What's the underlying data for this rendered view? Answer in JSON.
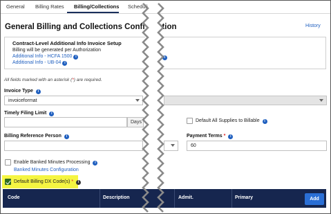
{
  "tabs": [
    {
      "label": "General"
    },
    {
      "label": "Billing Rates"
    },
    {
      "label": "Billing/Collections"
    },
    {
      "label": "Scheduli"
    }
  ],
  "page_title": "General Billing and Collections Configuration",
  "history_link": "History",
  "setup": {
    "title": "Contract-Level Additional Info Invoice Setup",
    "subtitle": "Billing will be generated per Authorization",
    "links": [
      "Additional Info - HCFA 1500",
      "Additional Info - UB-04"
    ]
  },
  "required_note": {
    "prefix": "All fields marked with an asterisk (",
    "asterisk": "*",
    "suffix": ") are required."
  },
  "invoice_type": {
    "label": "Invoice Type",
    "value": "invoiceformat"
  },
  "timely_filing": {
    "label": "Timely Filing Limit",
    "value": "",
    "addon": "Days"
  },
  "default_supplies": {
    "label": "Default All Supplies to Billable",
    "checked": false
  },
  "billing_reference": {
    "label": "Billing Reference Person",
    "value": ""
  },
  "payment_terms": {
    "label": "Payment Terms",
    "required_mark": "*",
    "value": "60"
  },
  "banked_minutes": {
    "label": "Enable Banked Minutes Processing",
    "checked": false,
    "link": "Banked Minutes Configuration"
  },
  "default_dx": {
    "label": "Default Billing DX Code(s)",
    "required_mark": "*",
    "checked": true
  },
  "table": {
    "columns": [
      "Code",
      "Description",
      "Admit.",
      "Primary"
    ],
    "add_button": "Add"
  },
  "colors": {
    "tab_underline": "#1a2f5c",
    "link": "#1f5fbf",
    "table_header": "#16264f",
    "add_button": "#2a6fd6",
    "highlight": "#f5f542",
    "checkbox_checked": "#2f6b1e"
  }
}
